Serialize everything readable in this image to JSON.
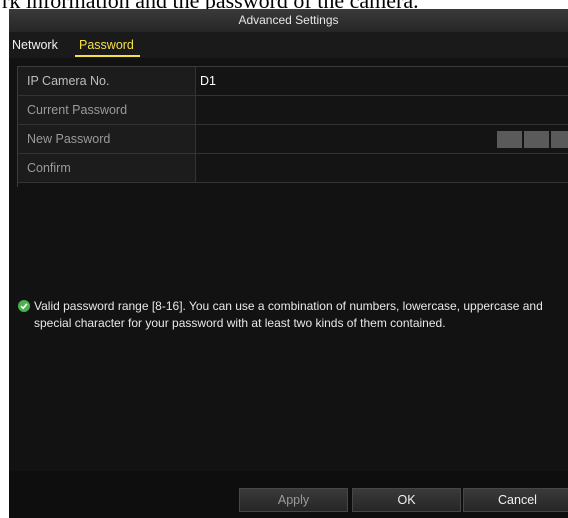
{
  "document": {
    "caption_text": "rk information and the password of the camera."
  },
  "window": {
    "title": "Advanced Settings"
  },
  "tabs": [
    {
      "label": "Network",
      "active": false
    },
    {
      "label": "Password",
      "active": true
    }
  ],
  "form": {
    "rows": [
      {
        "label": "IP Camera No.",
        "value": "D1"
      },
      {
        "label": "Current Password",
        "value": ""
      },
      {
        "label": "New Password",
        "value": ""
      },
      {
        "label": "Confirm",
        "value": ""
      }
    ],
    "strength_segments": 3
  },
  "info": {
    "icon": "check-circle-icon",
    "text": "Valid password range [8-16]. You can use a combination of numbers, lowercase, uppercase and special character for your password with at least two kinds of them contained."
  },
  "buttons": {
    "apply": "Apply",
    "ok": "OK",
    "cancel": "Cancel"
  },
  "colors": {
    "active_tab": "#f4e04a",
    "success_icon": "#4caf50"
  }
}
